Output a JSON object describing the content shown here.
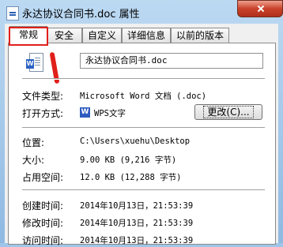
{
  "window": {
    "title": "永达协议合同书.doc 属性"
  },
  "tabs": [
    {
      "label": "常规",
      "active": true
    },
    {
      "label": "安全",
      "active": false
    },
    {
      "label": "自定义",
      "active": false
    },
    {
      "label": "详细信息",
      "active": false
    },
    {
      "label": "以前的版本",
      "active": false
    }
  ],
  "file": {
    "name": "永达协议合同书.doc",
    "icon": "word-doc-icon"
  },
  "props": {
    "type_label": "文件类型:",
    "type_value": "Microsoft Word 文档 (.doc)",
    "opens_label": "打开方式:",
    "opens_app": "WPS文字",
    "change_button": "更改(C)...",
    "location_label": "位置:",
    "location_value": "C:\\Users\\xuehu\\Desktop",
    "size_label": "大小:",
    "size_value": "9.00 KB (9,216 字节)",
    "disk_label": "占用空间:",
    "disk_value": "12.0 KB (12,288 字节)",
    "created_label": "创建时间:",
    "created_value": "2014年10月13日，21:53:39",
    "modified_label": "修改时间:",
    "modified_value": "2014年10月13日，21:53:39",
    "accessed_label": "访问时间:",
    "accessed_value": "2014年10月13日，21:53:39"
  },
  "colors": {
    "highlight": "#e0201a",
    "title_bar": "#bcd9f2",
    "close": "#c9422b"
  }
}
